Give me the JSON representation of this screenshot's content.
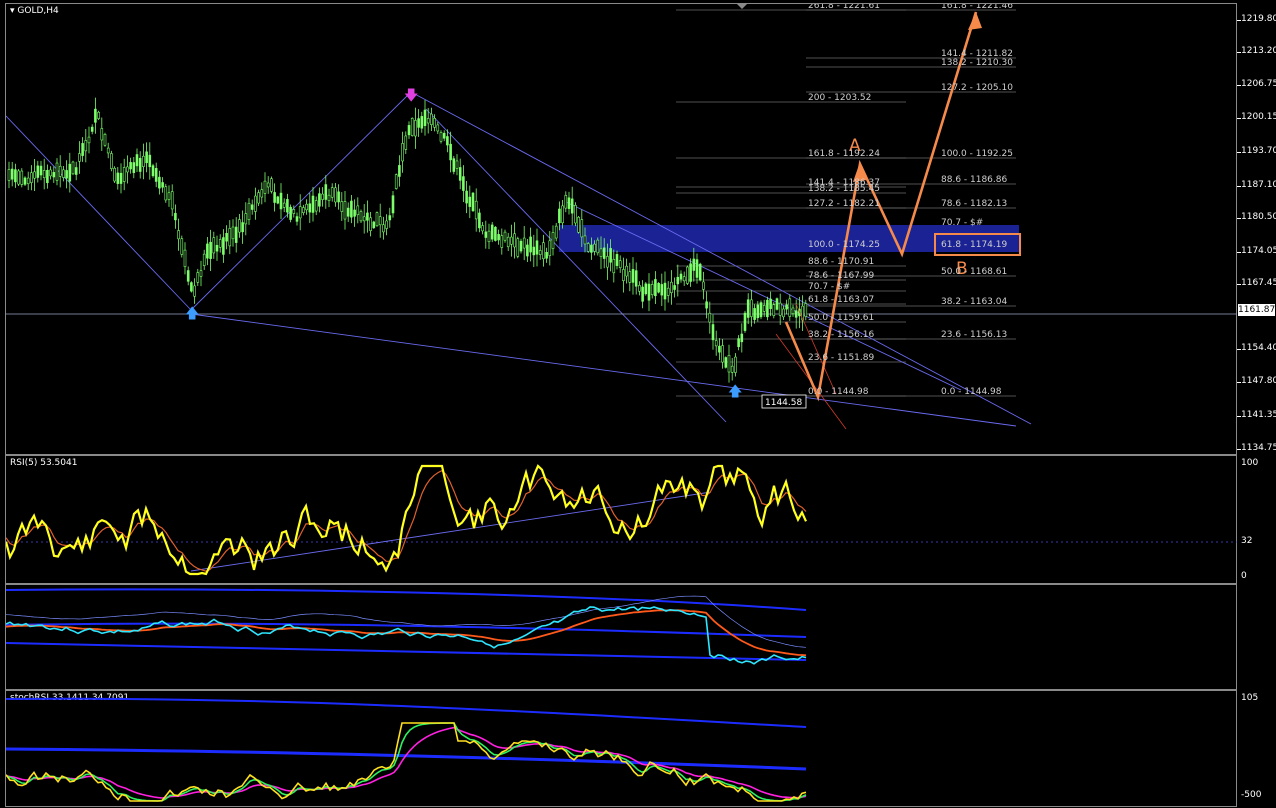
{
  "symbol": "GOLD,H4",
  "main": {
    "price_labels": [
      "1219.80",
      "1213.20",
      "1206.75",
      "1200.15",
      "1193.70",
      "1187.10",
      "1180.50",
      "1174.05",
      "1167.45",
      "1161.87",
      "1154.40",
      "1147.80",
      "1141.35",
      "1134.75"
    ],
    "current_price": "1161.87",
    "low_marker": "1144.58",
    "fib_left": [
      "261.8 - 1221.61",
      "200 - 1203.52",
      "161.8 - 1192.24",
      "141.4 - 1186.37",
      "138.2 - 1185.45",
      "127.2 - 1182.21",
      "100.0 - 1174.25",
      "88.6 - 1170.91",
      "78.6 - 1167.99",
      "70.7 - $#",
      "61.8 - 1163.07",
      "50.0 - 1159.61",
      "38.2 - 1156.16",
      "23.6 - 1151.89",
      "0.0 - 1144.98"
    ],
    "fib_right": [
      "161.8 - 1221.46",
      "141.4 - 1211.82",
      "138.2 - 1210.30",
      "127.2 - 1205.10",
      "100.0 - 1192.25",
      "88.6 - 1186.86",
      "78.6 - 1182.13",
      "70.7 - $#",
      "61.8 - 1174.19",
      "50.0 - 1168.61",
      "38.2 - 1163.04",
      "23.6 - 1156.13",
      "0.0 - 1144.98"
    ],
    "wave_labels": [
      "A",
      "B"
    ],
    "colors": {
      "bull": "#7cff6b",
      "bear": "#7cff6b",
      "arrow": "#f58a4b",
      "zone": "#1a2294",
      "trend": "#6a6af0"
    }
  },
  "rsi": {
    "title": "RSI(5) 53.5041",
    "labels": [
      "100",
      "32",
      "0"
    ]
  },
  "bands": {
    "title": ""
  },
  "stoch": {
    "title": "stochRSI 33.1411 34.7091",
    "labels": [
      "105",
      "-500"
    ]
  }
}
